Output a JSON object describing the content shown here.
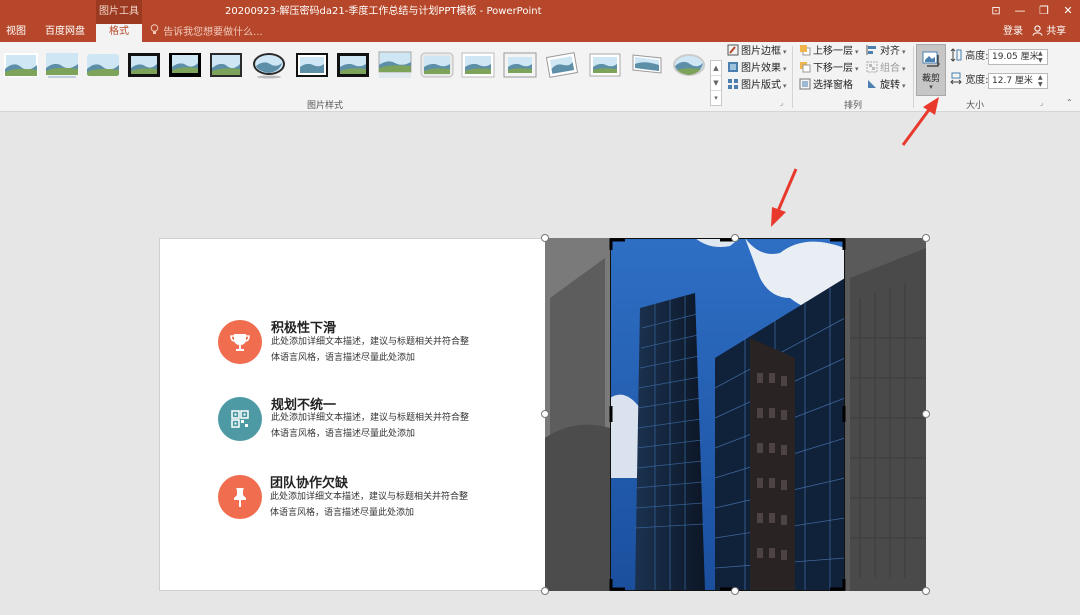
{
  "titlebar": {
    "context_label": "图片工具",
    "doc_title": "20200923-解压密码da21-季度工作总结与计划PPT模板 - PowerPoint",
    "controls": [
      "⊡",
      "—",
      "❐",
      "✕"
    ]
  },
  "tabs": {
    "view": "视图",
    "baidu": "百度网盘",
    "format": "格式",
    "tellme": "告诉我您想要做什么...",
    "login": "登录",
    "share": "共享"
  },
  "ribbon": {
    "picture_styles_label": "图片样式",
    "picture_border": "图片边框",
    "picture_effects": "图片效果",
    "picture_layout": "图片版式",
    "arrange_label": "排列",
    "bring_forward": "上移一层",
    "send_backward": "下移一层",
    "selection_pane": "选择窗格",
    "align": "对齐",
    "group": "组合",
    "rotate": "旋转",
    "crop": "裁剪",
    "size_label": "大小",
    "height_label": "高度:",
    "height_value": "19.05 厘米",
    "width_label": "宽度:",
    "width_value": "12.7 厘米"
  },
  "slide": {
    "items": [
      {
        "title": "积极性下滑",
        "desc": "此处添加详细文本描述，建议与标题相关并符合整体语言风格，语言描述尽量此处添加",
        "color": "#f06d4f",
        "icon": "trophy-icon"
      },
      {
        "title": "规划不统一",
        "desc": "此处添加详细文本描述，建议与标题相关并符合整体语言风格，语言描述尽量此处添加",
        "color": "#4e9aa4",
        "icon": "qr-grid-icon"
      },
      {
        "title": "团队协作欠缺",
        "desc": "此处添加详细文本描述，建议与标题相关并符合整体语言风格，语言描述尽量此处添加",
        "color": "#f06d4f",
        "icon": "pushpin-icon"
      }
    ]
  },
  "colors": {
    "accent": "#b7472a",
    "arrow": "#e8392c"
  }
}
